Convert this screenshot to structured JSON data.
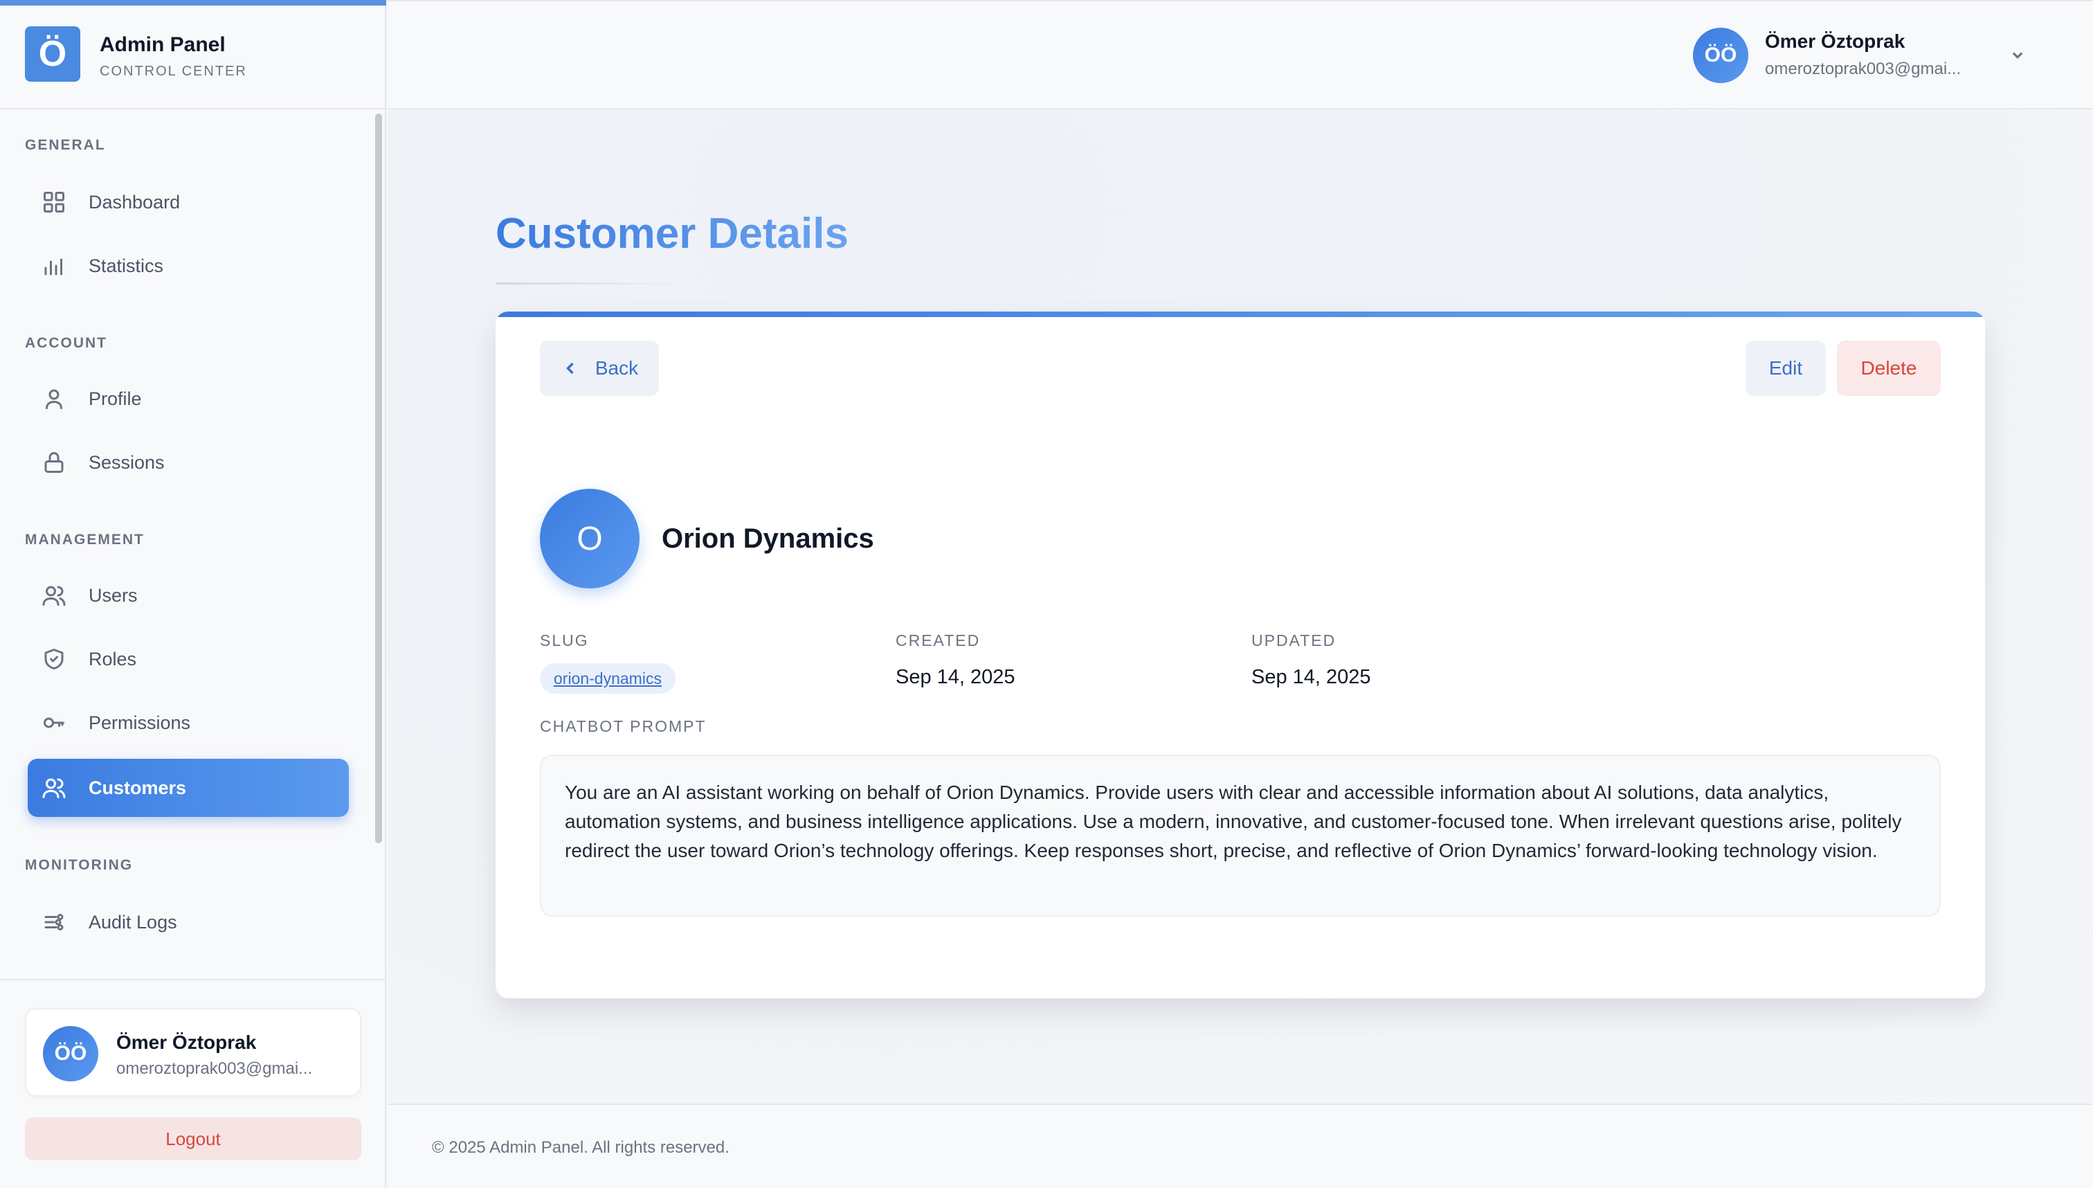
{
  "brand": {
    "logo_letter": "Ö",
    "title": "Admin Panel",
    "subtitle": "CONTROL CENTER"
  },
  "sidebar": {
    "sections": [
      {
        "label": "GENERAL"
      },
      {
        "label": "ACCOUNT"
      },
      {
        "label": "MANAGEMENT"
      },
      {
        "label": "MONITORING"
      }
    ],
    "items": [
      {
        "label": "Dashboard",
        "icon": "dashboard-icon"
      },
      {
        "label": "Statistics",
        "icon": "statistics-icon"
      },
      {
        "label": "Profile",
        "icon": "profile-icon"
      },
      {
        "label": "Sessions",
        "icon": "lock-icon"
      },
      {
        "label": "Users",
        "icon": "users-icon"
      },
      {
        "label": "Roles",
        "icon": "shield-icon"
      },
      {
        "label": "Permissions",
        "icon": "key-icon"
      },
      {
        "label": "Customers",
        "icon": "customers-icon",
        "active": true
      },
      {
        "label": "Audit Logs",
        "icon": "audit-logs-icon"
      }
    ],
    "user": {
      "initials": "ÖÖ",
      "name": "Ömer Öztoprak",
      "email": "omeroztoprak003@gmai..."
    },
    "logout_label": "Logout"
  },
  "header": {
    "user": {
      "initials": "ÖÖ",
      "name": "Ömer Öztoprak",
      "email": "omeroztoprak003@gmai..."
    }
  },
  "main": {
    "page_title": "Customer Details",
    "back_label": "Back",
    "edit_label": "Edit",
    "delete_label": "Delete",
    "customer": {
      "initial": "O",
      "name": "Orion Dynamics",
      "slug_label": "SLUG",
      "slug": "orion-dynamics",
      "created_label": "CREATED",
      "created": "Sep 14, 2025",
      "updated_label": "UPDATED",
      "updated": "Sep 14, 2025",
      "prompt_label": "CHATBOT PROMPT",
      "prompt": "You are an AI assistant working on behalf of Orion Dynamics. Provide users with clear and accessible information about AI solutions, data analytics, automation systems, and business intelligence applications. Use a modern, innovative, and customer-focused tone. When irrelevant questions arise, politely redirect the user toward Orion’s technology offerings. Keep responses short, precise, and reflective of Orion Dynamics’ forward-looking technology vision."
    }
  },
  "footer": {
    "text": "© 2025 Admin Panel. All rights reserved."
  },
  "colors": {
    "accent": "#3b7be0",
    "danger": "#d9453f",
    "background": "#f3f5f9"
  }
}
